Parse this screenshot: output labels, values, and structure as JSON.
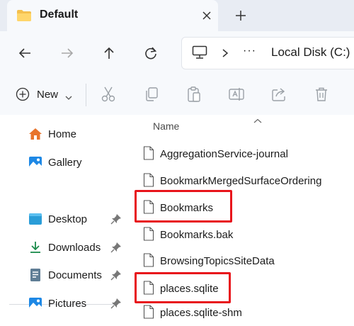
{
  "tab": {
    "title": "Default"
  },
  "address": {
    "more": "···",
    "path": "Local Disk (C:)"
  },
  "toolbar": {
    "new_label": "New"
  },
  "sidebar": {
    "items": [
      {
        "label": "Home"
      },
      {
        "label": "Gallery"
      },
      {
        "label": "Desktop"
      },
      {
        "label": "Downloads"
      },
      {
        "label": "Documents"
      },
      {
        "label": "Pictures"
      }
    ]
  },
  "content": {
    "column_name": "Name",
    "files": [
      {
        "name": "AggregationService-journal"
      },
      {
        "name": "BookmarkMergedSurfaceOrdering"
      },
      {
        "name": "Bookmarks"
      },
      {
        "name": "Bookmarks.bak"
      },
      {
        "name": "BrowsingTopicsSiteData"
      },
      {
        "name": "places.sqlite"
      },
      {
        "name": "places.sqlite-shm"
      }
    ]
  },
  "colors": {
    "highlight": "#e8141b",
    "accent": "#0a6fc2"
  }
}
